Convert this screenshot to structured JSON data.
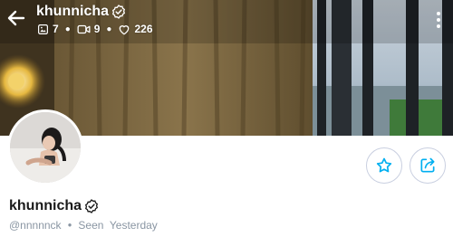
{
  "header": {
    "username": "khunnicha",
    "verified": true,
    "stats": {
      "photos": "7",
      "videos": "9",
      "likes": "226"
    }
  },
  "profile": {
    "display_name": "khunnicha",
    "verified": true,
    "handle": "@nnnnnck",
    "last_seen": "Seen  Yesterday"
  },
  "icons": {
    "back": "arrow-left-icon",
    "more": "more-vertical-icon",
    "photo": "image-icon",
    "video": "video-icon",
    "likes": "heart-icon",
    "verified": "verified-badge-icon",
    "favorite": "star-icon",
    "share": "share-icon"
  },
  "colors": {
    "accent": "#00aff0",
    "muted_text": "#8a96a3",
    "text": "#1a1a1a"
  }
}
